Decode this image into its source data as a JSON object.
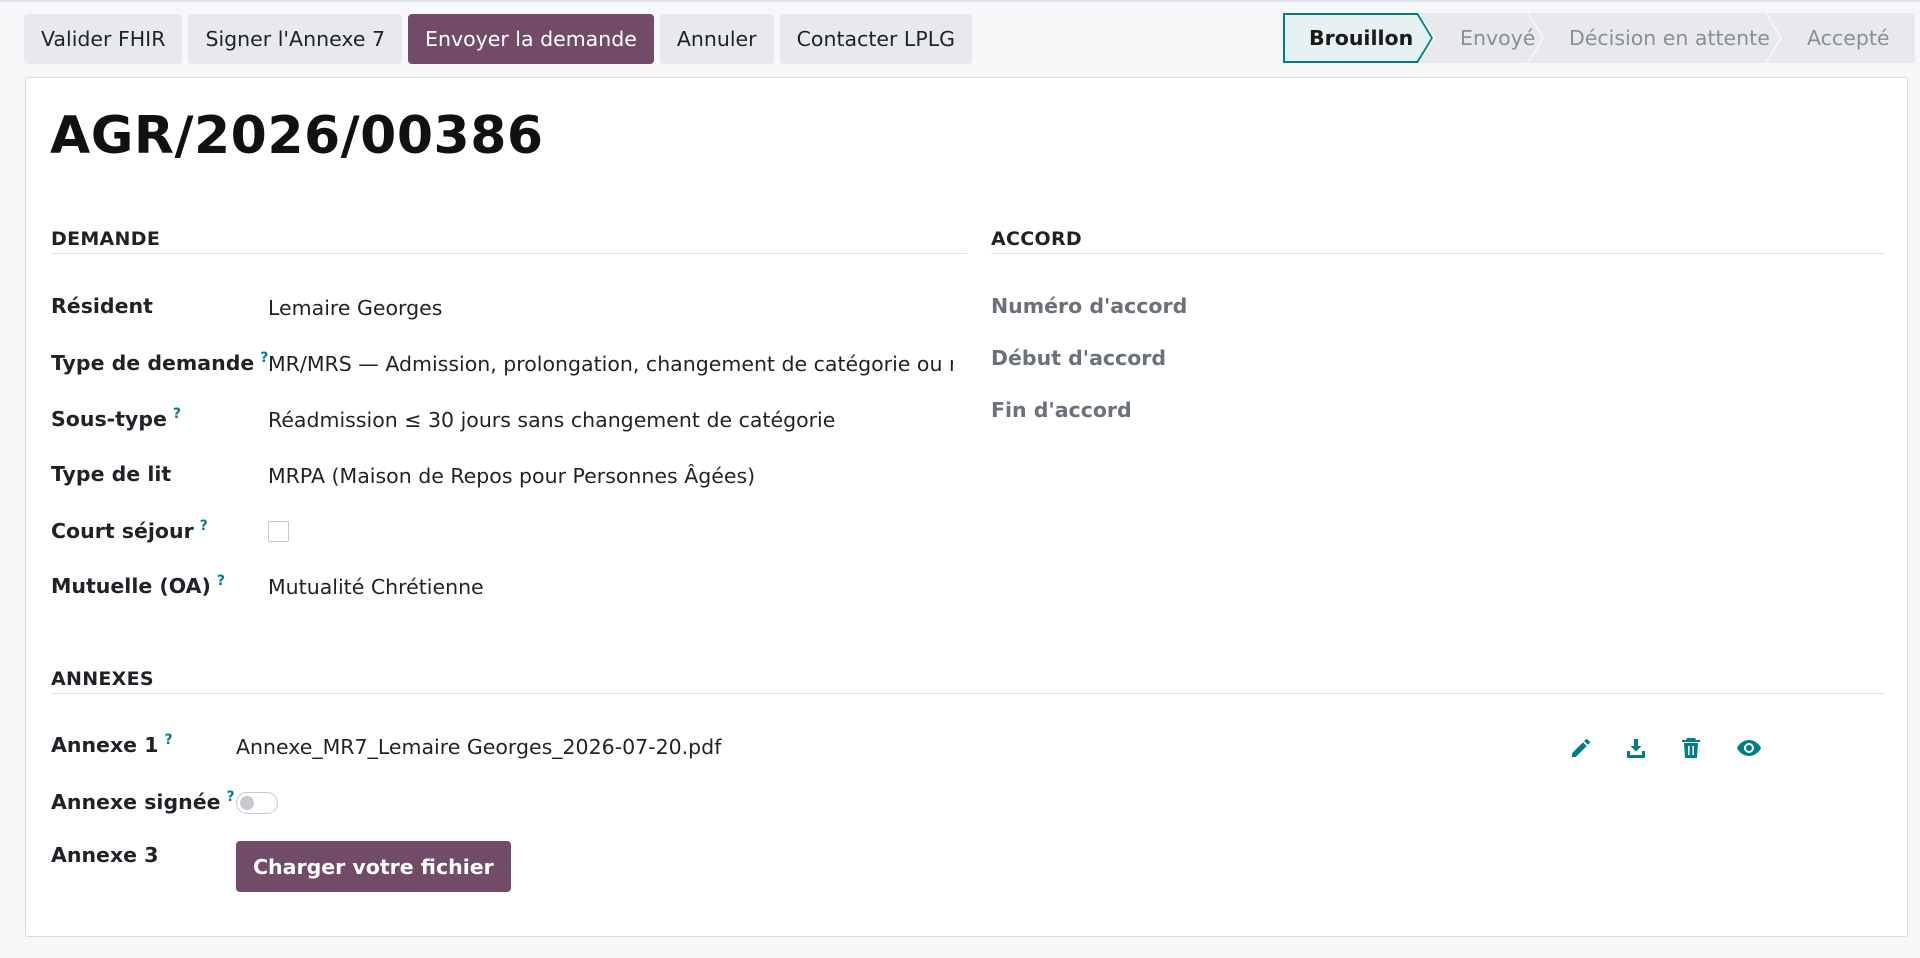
{
  "toolbar": {
    "buttons": [
      {
        "label": "Valider FHIR"
      },
      {
        "label": "Signer l'Annexe 7"
      },
      {
        "label": "Envoyer la demande"
      },
      {
        "label": "Annuler"
      },
      {
        "label": "Contacter LPLG"
      }
    ]
  },
  "status": {
    "stages": [
      "Brouillon",
      "Envoyé",
      "Décision en attente",
      "Accepté"
    ],
    "current": "Brouillon"
  },
  "record": {
    "title": "AGR/2026/00386"
  },
  "demande": {
    "section_title": "DEMANDE",
    "fields": {
      "resident": {
        "label": "Résident",
        "value": "Lemaire Georges"
      },
      "type_demande": {
        "label": "Type de demande",
        "help": "?",
        "value": "MR/MRS — Admission, prolongation, changement de catégorie ou réa"
      },
      "sous_type": {
        "label": "Sous-type",
        "help": "?",
        "value": "Réadmission ≤ 30 jours sans changement de catégorie"
      },
      "type_lit": {
        "label": "Type de lit",
        "value": "MRPA (Maison de Repos pour Personnes Âgées)"
      },
      "court_sejour": {
        "label": "Court séjour",
        "help": "?",
        "checked": false
      },
      "mutuelle": {
        "label": "Mutuelle (OA)",
        "help": "?",
        "value": "Mutualité Chrétienne"
      }
    }
  },
  "accord": {
    "section_title": "ACCORD",
    "fields": {
      "numero": {
        "label": "Numéro d'accord"
      },
      "debut": {
        "label": "Début d'accord"
      },
      "fin": {
        "label": "Fin d'accord"
      }
    }
  },
  "annexes": {
    "section_title": "ANNEXES",
    "annexe1": {
      "label": "Annexe 1",
      "help": "?",
      "filename": "Annexe_MR7_Lemaire Georges_2026-07-20.pdf",
      "actions": [
        "edit-icon",
        "download-icon",
        "trash-icon",
        "eye-icon"
      ]
    },
    "annexe_signee": {
      "label": "Annexe signée",
      "help": "?",
      "on": false
    },
    "annexe3": {
      "label": "Annexe 3",
      "button_label": "Charger votre fichier"
    }
  },
  "colors": {
    "primary": "#714b67",
    "accent": "#017e84",
    "button_bg": "#e7e9ed"
  }
}
